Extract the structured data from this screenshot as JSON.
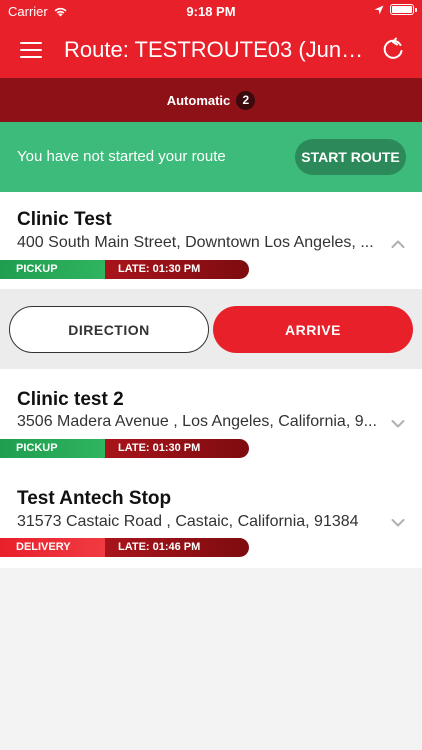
{
  "status_bar": {
    "carrier": "Carrier",
    "time": "9:18 PM"
  },
  "nav": {
    "title": "Route: TESTROUTE03 (Jun 3...",
    "menu_icon": "hamburger-menu-icon",
    "refresh_icon": "refresh-icon"
  },
  "filter": {
    "label": "Automatic",
    "count": "2"
  },
  "route_start": {
    "message": "You have not started your route",
    "button_label": "START ROUTE"
  },
  "stops": [
    {
      "name": "Clinic Test",
      "address": "400 South Main Street, Downtown Los Angeles, ...",
      "type_label": "PICKUP",
      "late_label": "LATE: 01:30 PM",
      "expanded": true
    },
    {
      "name": "Clinic test 2",
      "address": "3506 Madera Avenue , Los Angeles, California, 9...",
      "type_label": "PICKUP",
      "late_label": "LATE: 01:30 PM",
      "expanded": false
    },
    {
      "name": "Test Antech Stop",
      "address": "31573 Castaic Road , Castaic, California, 91384",
      "type_label": "DELIVERY",
      "late_label": "LATE: 01:46 PM",
      "expanded": false
    }
  ],
  "actions": {
    "direction_label": "DIRECTION",
    "arrive_label": "ARRIVE"
  },
  "colors": {
    "brand_red": "#e8202a",
    "dark_red": "#8e1117",
    "start_green": "#3dbb7a",
    "pickup_green": "#2fb45f"
  }
}
